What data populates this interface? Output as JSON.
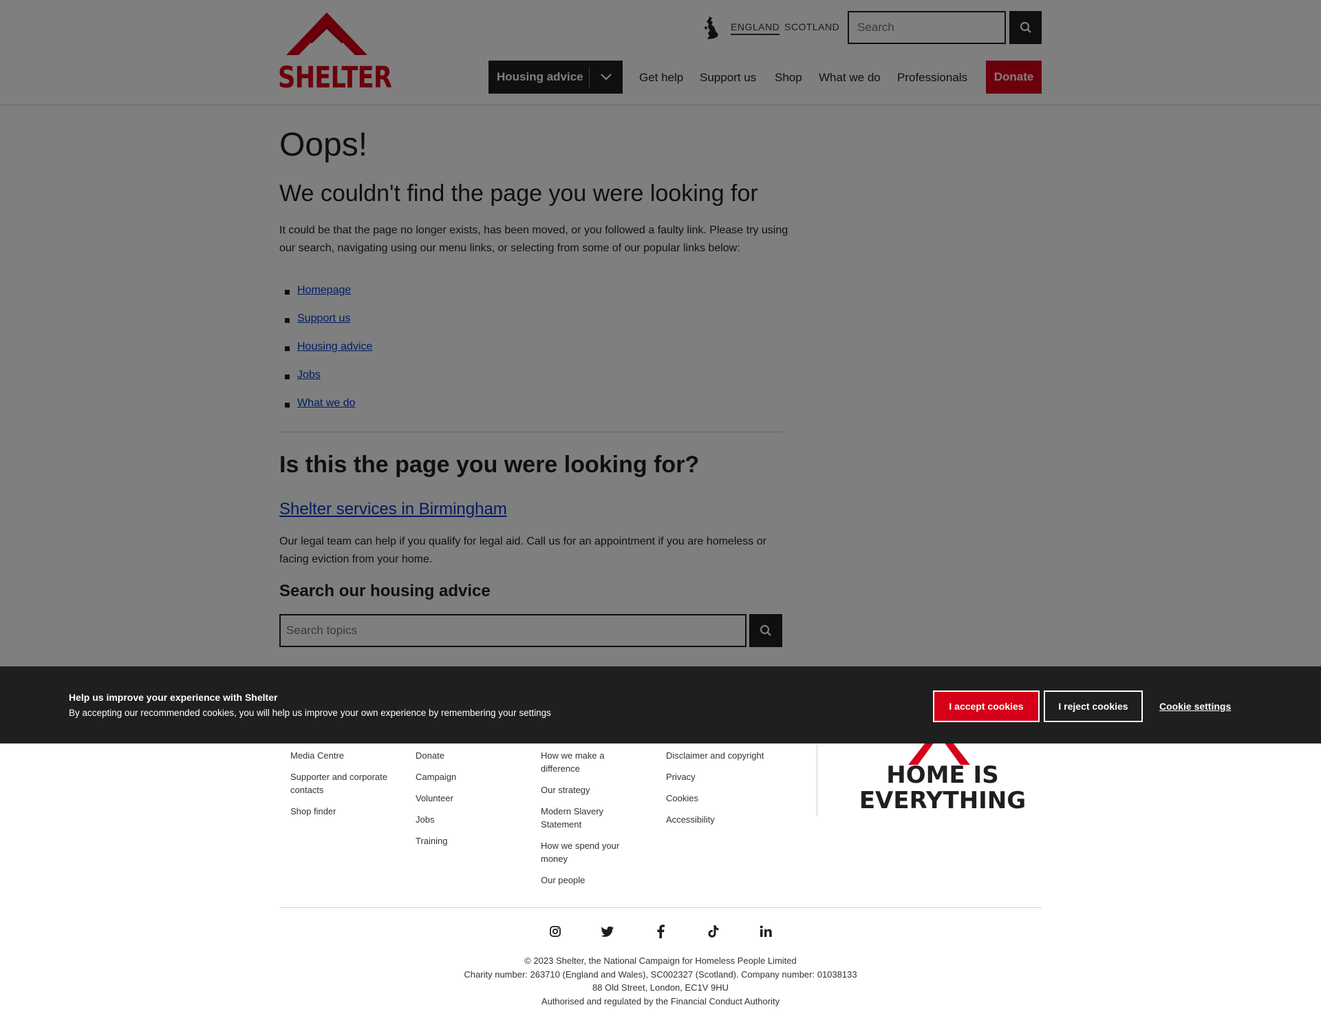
{
  "brand": {
    "name": "SHELTER",
    "accent": "#d60019",
    "dark": "#1f1f1f",
    "link": "#0039c7"
  },
  "header": {
    "countries": [
      "ENGLAND",
      "SCOTLAND"
    ],
    "search_placeholder": "Search",
    "nav": {
      "housing_advice": "Housing advice",
      "links": [
        "Get help",
        "Support us",
        "Shop",
        "What we do",
        "Professionals"
      ],
      "donate": "Donate"
    }
  },
  "main": {
    "title": "Oops!",
    "subtitle": "We couldn't find the page you were looking for",
    "intro": "It could be that the page no longer exists, has been moved, or you followed a faulty link. Please try using our search, navigating using our menu links, or selecting from some of our popular links below:",
    "popular_links": [
      "Homepage",
      "Support us",
      "Housing advice",
      "Jobs",
      "What we do"
    ],
    "suggest_heading": "Is this the page you were looking for?",
    "suggest_link": "Shelter services in Birmingham",
    "suggest_text": "Our legal team can help if you qualify for legal aid. Call us for an appointment if you are homeless or facing eviction from your home.",
    "search_heading": "Search our housing advice",
    "search_placeholder": "Search topics"
  },
  "cookie": {
    "title": "Help us improve your experience with Shelter",
    "text": "By accepting our recommended cookies, you will help us improve your own experience by remembering your settings",
    "accept": "I accept cookies",
    "reject": "I reject cookies",
    "settings": "Cookie settings"
  },
  "footer": {
    "col1": [
      "Media Centre",
      "Supporter and corporate contacts",
      "Shop finder"
    ],
    "col2": [
      "Donate",
      "Campaign",
      "Volunteer",
      "Jobs",
      "Training"
    ],
    "col3": [
      "How we make a difference",
      "Our strategy",
      "Modern Slavery Statement",
      "How we spend your money",
      "Our people"
    ],
    "col4": [
      "Disclaimer and copyright",
      "Privacy",
      "Cookies",
      "Accessibility"
    ],
    "slogan_line1": "HOME IS",
    "slogan_line2": "EVERYTHING",
    "social": [
      "instagram-icon",
      "twitter-icon",
      "facebook-icon",
      "tiktok-icon",
      "linkedin-icon"
    ],
    "legal": [
      "© 2023 Shelter, the National Campaign for Homeless People Limited",
      "Charity number: 263710 (England and Wales), SC002327 (Scotland). Company number: 01038133",
      "88 Old Street, London, EC1V 9HU",
      "Authorised and regulated by the Financial Conduct Authority"
    ]
  }
}
